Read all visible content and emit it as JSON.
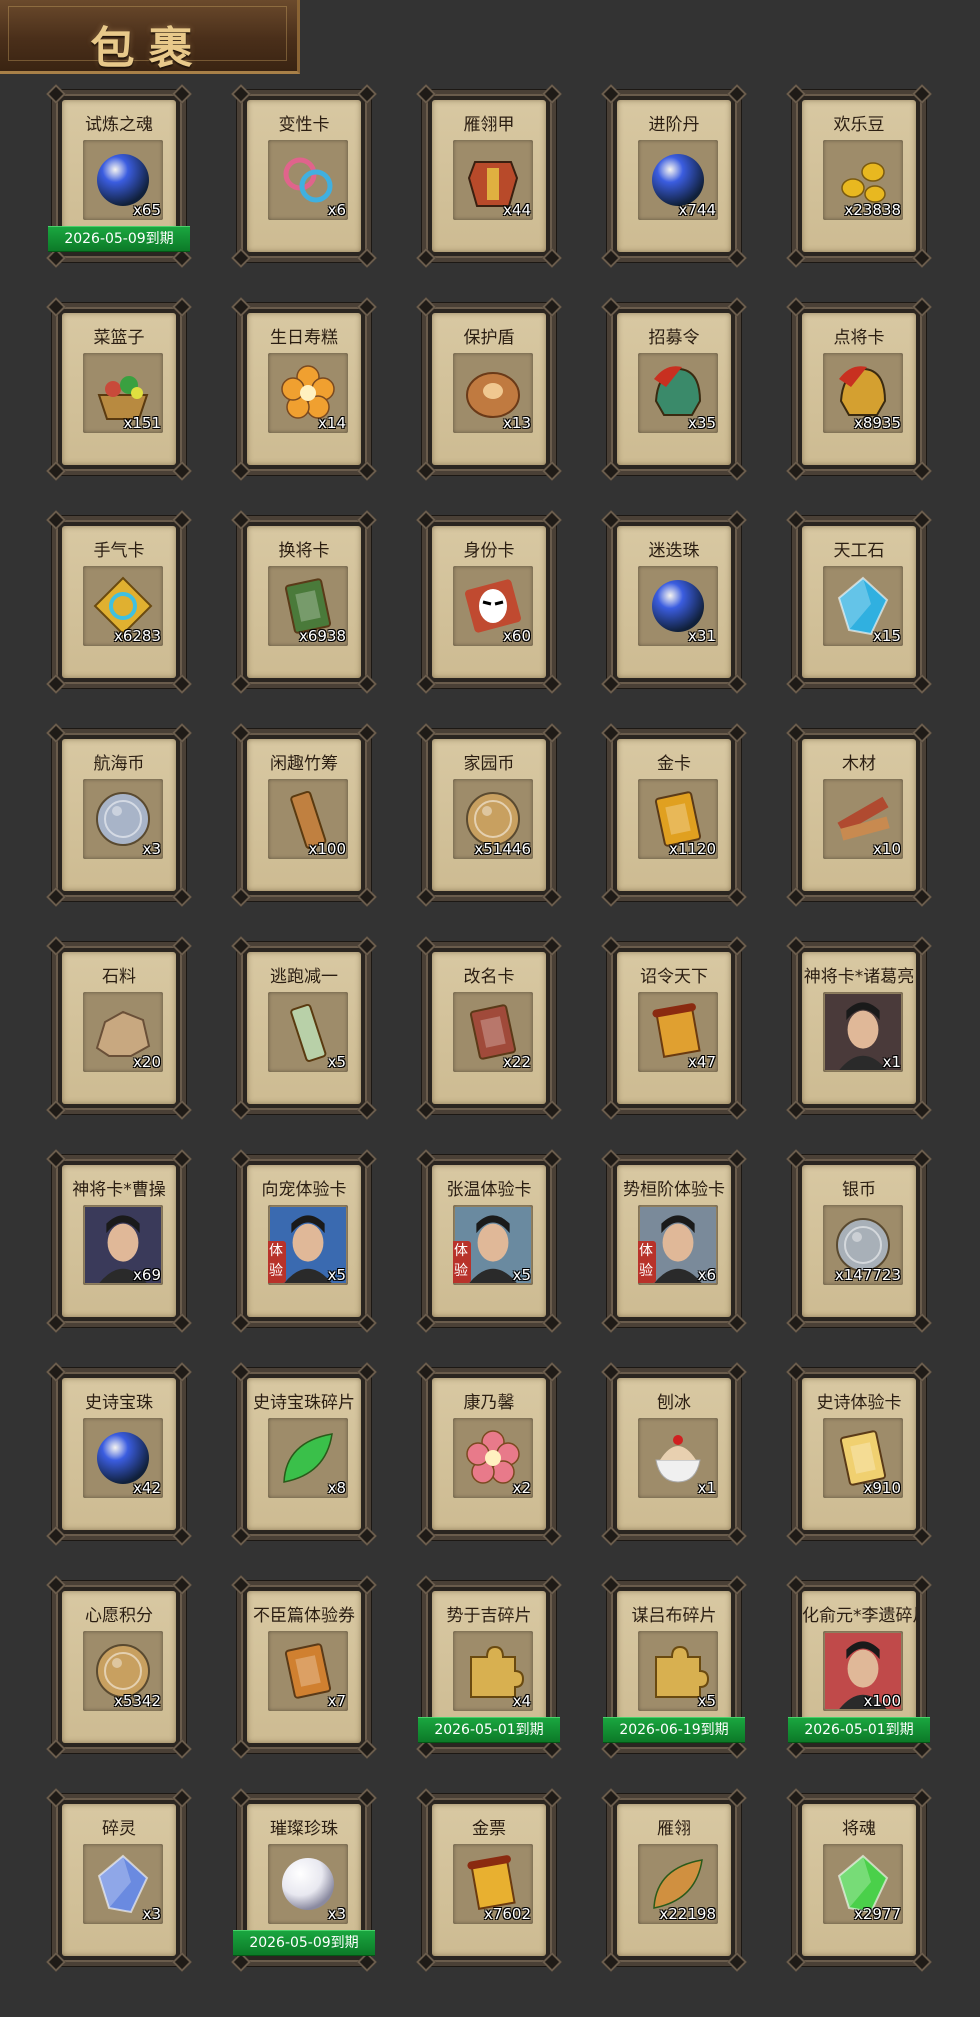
{
  "header": {
    "title": "包裹"
  },
  "items": [
    {
      "name": "试炼之魂",
      "count": "x65",
      "expiry": "2026-05-09到期",
      "icon": "soul-orb-icon",
      "color": "#3b5de0",
      "shape": "orb"
    },
    {
      "name": "变性卡",
      "count": "x6",
      "icon": "gender-card-icon",
      "color": "#e0648c",
      "shape": "ring"
    },
    {
      "name": "雁翎甲",
      "count": "x44",
      "icon": "armor-icon",
      "color": "#b84a2a",
      "shape": "armor"
    },
    {
      "name": "进阶丹",
      "count": "x744",
      "icon": "pill-icon",
      "color": "#3fbf3f",
      "shape": "orb"
    },
    {
      "name": "欢乐豆",
      "count": "x23838",
      "icon": "bean-icon",
      "color": "#e8b820",
      "shape": "beans"
    },
    {
      "name": "菜篮子",
      "count": "x151",
      "icon": "basket-icon",
      "color": "#c84a3a",
      "shape": "basket"
    },
    {
      "name": "生日寿糕",
      "count": "x14",
      "icon": "cake-icon",
      "color": "#f0a030",
      "shape": "flower"
    },
    {
      "name": "保护盾",
      "count": "x13",
      "icon": "shield-icon",
      "color": "#c07a40",
      "shape": "disc"
    },
    {
      "name": "招募令",
      "count": "x35",
      "icon": "recruit-token-icon",
      "color": "#3a8a6a",
      "shape": "helmet"
    },
    {
      "name": "点将卡",
      "count": "x8935",
      "icon": "general-card-icon",
      "color": "#d4a030",
      "shape": "helmet"
    },
    {
      "name": "手气卡",
      "count": "x6283",
      "icon": "luck-card-icon",
      "color": "#e0b030",
      "shape": "diamond"
    },
    {
      "name": "换将卡",
      "count": "x6938",
      "icon": "swap-card-icon",
      "color": "#4a7a3a",
      "shape": "card"
    },
    {
      "name": "身份卡",
      "count": "x60",
      "icon": "identity-card-icon",
      "color": "#c04a30",
      "shape": "mask"
    },
    {
      "name": "迷迭珠",
      "count": "x31",
      "icon": "blue-orb-icon",
      "color": "#3a8ae0",
      "shape": "orb"
    },
    {
      "name": "天工石",
      "count": "x15",
      "icon": "crystal-icon",
      "color": "#30b0e0",
      "shape": "gem"
    },
    {
      "name": "航海币",
      "count": "x3",
      "icon": "silver-coin-icon",
      "color": "#a8b4c8",
      "shape": "coin"
    },
    {
      "name": "闲趣竹筹",
      "count": "x100",
      "icon": "bamboo-tally-icon",
      "color": "#c08040",
      "shape": "tally"
    },
    {
      "name": "家园币",
      "count": "x51446",
      "icon": "home-coin-icon",
      "color": "#c8a060",
      "shape": "coin"
    },
    {
      "name": "金卡",
      "count": "x1120",
      "icon": "gold-card-icon",
      "color": "#e0a020",
      "shape": "card"
    },
    {
      "name": "木材",
      "count": "x10",
      "icon": "wood-icon",
      "color": "#b04a30",
      "shape": "wood"
    },
    {
      "name": "石料",
      "count": "x20",
      "icon": "stone-icon",
      "color": "#c8a880",
      "shape": "rock"
    },
    {
      "name": "逃跑减一",
      "count": "x5",
      "icon": "tag-icon",
      "color": "#b8d0a8",
      "shape": "tally"
    },
    {
      "name": "改名卡",
      "count": "x22",
      "icon": "rename-card-icon",
      "color": "#a04a3a",
      "shape": "card"
    },
    {
      "name": "诏令天下",
      "count": "x47",
      "icon": "scroll-icon",
      "color": "#e0a030",
      "shape": "scroll"
    },
    {
      "name": "神将卡*诸葛亮",
      "count": "x1",
      "icon": "portrait-icon",
      "color": "#4a3a3a",
      "shape": "portrait"
    },
    {
      "name": "神将卡*曹操",
      "count": "x69",
      "icon": "portrait-icon",
      "color": "#3a3a5a",
      "shape": "portrait"
    },
    {
      "name": "向宠体验卡",
      "count": "x5",
      "trial": "体验",
      "icon": "portrait-icon",
      "color": "#3a6ab0",
      "shape": "portrait"
    },
    {
      "name": "张温体验卡",
      "count": "x5",
      "trial": "体验",
      "icon": "portrait-icon",
      "color": "#6a8aa0",
      "shape": "portrait"
    },
    {
      "name": "势桓阶体验卡",
      "count": "x6",
      "trial": "体验",
      "icon": "portrait-icon",
      "color": "#7a8a9a",
      "shape": "portrait"
    },
    {
      "name": "银币",
      "count": "x147723",
      "icon": "silver-coins-icon",
      "color": "#a8b0b8",
      "shape": "coin"
    },
    {
      "name": "史诗宝珠",
      "count": "x42",
      "icon": "green-orb-icon",
      "color": "#3ac04a",
      "shape": "orb"
    },
    {
      "name": "史诗宝珠碎片",
      "count": "x8",
      "icon": "leaf-shard-icon",
      "color": "#3ac04a",
      "shape": "leaf"
    },
    {
      "name": "康乃馨",
      "count": "x2",
      "icon": "carnation-icon",
      "color": "#e87a8a",
      "shape": "flower"
    },
    {
      "name": "刨冰",
      "count": "x1",
      "icon": "shaved-ice-icon",
      "color": "#e8d0b0",
      "shape": "bowl"
    },
    {
      "name": "史诗体验卡",
      "count": "x910",
      "icon": "yellow-card-icon",
      "color": "#f0d070",
      "shape": "card"
    },
    {
      "name": "心愿积分",
      "count": "x5342",
      "icon": "heart-coin-icon",
      "color": "#c8a060",
      "shape": "coin"
    },
    {
      "name": "不臣篇体验券",
      "count": "x7",
      "icon": "ticket-icon",
      "color": "#d08030",
      "shape": "card"
    },
    {
      "name": "势于吉碎片",
      "count": "x4",
      "expiry": "2026-05-01到期",
      "icon": "puzzle-icon",
      "color": "#d8b050",
      "shape": "puzzle"
    },
    {
      "name": "谋吕布碎片",
      "count": "x5",
      "expiry": "2026-06-19到期",
      "icon": "puzzle-icon",
      "color": "#d8b050",
      "shape": "puzzle"
    },
    {
      "name": "化俞元*李遗碎片",
      "count": "x100",
      "expiry": "2026-05-01到期",
      "icon": "portrait-icon",
      "color": "#c04a4a",
      "shape": "portrait"
    },
    {
      "name": "碎灵",
      "count": "x3",
      "icon": "shard-icon",
      "color": "#6a8ae0",
      "shape": "gem"
    },
    {
      "name": "璀璨珍珠",
      "count": "x3",
      "expiry": "2026-05-09到期",
      "icon": "pearl-icon",
      "color": "#e8e8f0",
      "shape": "pearl"
    },
    {
      "name": "金票",
      "count": "x7602",
      "icon": "gold-ticket-icon",
      "color": "#e8b030",
      "shape": "scroll"
    },
    {
      "name": "雁翎",
      "count": "x22198",
      "icon": "feather-icon",
      "color": "#d09040",
      "shape": "leaf"
    },
    {
      "name": "将魂",
      "count": "x2977",
      "icon": "soul-crystal-icon",
      "color": "#4ad04a",
      "shape": "gem"
    }
  ]
}
